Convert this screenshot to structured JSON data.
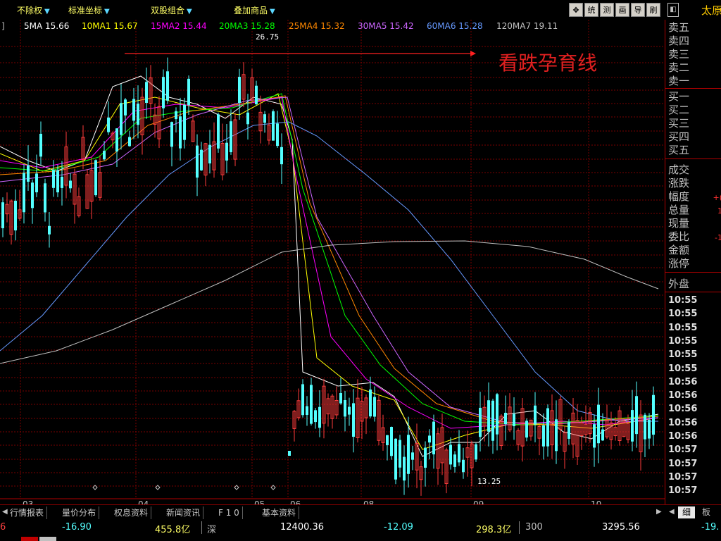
{
  "toolbar": {
    "items": [
      {
        "label": "不除权"
      },
      {
        "label": "标准坐标"
      },
      {
        "label": "双股组合"
      },
      {
        "label": "叠加商品"
      }
    ],
    "buttons": [
      "统",
      "测",
      "画",
      "导",
      "刷"
    ],
    "move_icon": "crosshair-move-icon",
    "panel_icon": "panel-toggle-icon",
    "title": "太原"
  },
  "ma_legend": {
    "bracket": "]",
    "items": [
      {
        "label": "5MA 15.66",
        "color": "#ffffff"
      },
      {
        "label": "10MA1 15.67",
        "color": "#ffff00"
      },
      {
        "label": "15MA2 15.44",
        "color": "#ff00ff"
      },
      {
        "label": "20MA3 15.28",
        "color": "#00ff00"
      },
      {
        "label": "25MA4 15.32",
        "color": "#ff8800"
      },
      {
        "label": "30MA5 15.42",
        "color": "#cc66ff"
      },
      {
        "label": "60MA6 15.28",
        "color": "#6699ff"
      },
      {
        "label": "120MA7 19.11",
        "color": "#c0c0c0"
      }
    ]
  },
  "chart": {
    "annotation_text": "看跌孕育线",
    "high_label": "26.75",
    "low_label": "13.25",
    "x_ticks": [
      "03",
      "04",
      "05",
      "06",
      "08",
      "09",
      "10"
    ],
    "up_color": "#ff3c3c",
    "down_color": "#54ffff",
    "grid_color": "#800000"
  },
  "side": {
    "ask_labels": [
      "卖五",
      "卖四",
      "卖三",
      "卖二",
      "卖一"
    ],
    "bid_labels": [
      "买一",
      "买二",
      "买三",
      "买四",
      "买五"
    ],
    "stats": [
      {
        "label": "成交",
        "value": ""
      },
      {
        "label": "涨跌",
        "value": ""
      },
      {
        "label": "幅度",
        "value": "+("
      },
      {
        "label": "总量",
        "value": "1"
      },
      {
        "label": "现量",
        "value": ""
      },
      {
        "label": "委比",
        "value": "-1"
      },
      {
        "label": "金额",
        "value": ""
      },
      {
        "label": "涨停",
        "value": ""
      }
    ],
    "outer": "外盘",
    "times": [
      "10:55",
      "10:55",
      "10:55",
      "10:55",
      "10:55",
      "10:55",
      "10:56",
      "10:56",
      "10:56",
      "10:56",
      "10:56",
      "10:57",
      "10:57",
      "10:57",
      "10:57"
    ]
  },
  "tabs": {
    "items": [
      "行情报表",
      "量价分布",
      "权息资料",
      "新闻资讯",
      "F 1 0",
      "基本资料"
    ],
    "right": [
      "细",
      "板"
    ]
  },
  "status": {
    "cells": [
      {
        "text": "6",
        "color": "#ff4040"
      },
      {
        "text": "-16.90",
        "color": "#54ffff"
      },
      {
        "text": "455.8亿",
        "color": "#ffff66"
      },
      {
        "text": "深",
        "color": "#c0c0c0"
      },
      {
        "text": "12400.36",
        "color": "#ffffff"
      },
      {
        "text": "-12.09",
        "color": "#54ffff"
      },
      {
        "text": "298.3亿",
        "color": "#ffff66"
      },
      {
        "text": "300",
        "color": "#c0c0c0"
      },
      {
        "text": "3295.56",
        "color": "#ffffff"
      },
      {
        "text": "-19.",
        "color": "#54ffff"
      }
    ]
  }
}
